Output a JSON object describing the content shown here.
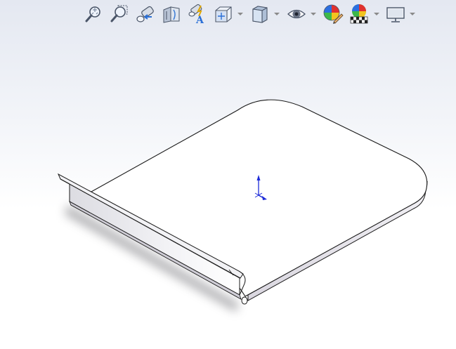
{
  "toolbar": {
    "buttons": [
      {
        "icon": "zoom-to-fit-icon",
        "has_dropdown": false
      },
      {
        "icon": "zoom-to-area-icon",
        "has_dropdown": false
      },
      {
        "icon": "previous-view-icon",
        "has_dropdown": false
      },
      {
        "icon": "section-view-icon",
        "has_dropdown": false
      },
      {
        "icon": "dynamic-annotation-views-icon",
        "has_dropdown": false
      },
      {
        "icon": "view-orientation-icon",
        "has_dropdown": true
      },
      {
        "icon": "display-style-icon",
        "has_dropdown": true
      },
      {
        "icon": "hide-show-items-icon",
        "has_dropdown": true
      },
      {
        "icon": "edit-appearance-icon",
        "has_dropdown": false
      },
      {
        "icon": "apply-scene-icon",
        "has_dropdown": true
      },
      {
        "icon": "view-settings-icon",
        "has_dropdown": true
      }
    ]
  },
  "colors": {
    "background_top": "#e4e8f1",
    "background_bottom": "#ffffff",
    "edge": "#1a1a1a",
    "face": "#ffffff",
    "side_face": "#e9e7ee",
    "triad_blue": "#1d2bd8"
  }
}
